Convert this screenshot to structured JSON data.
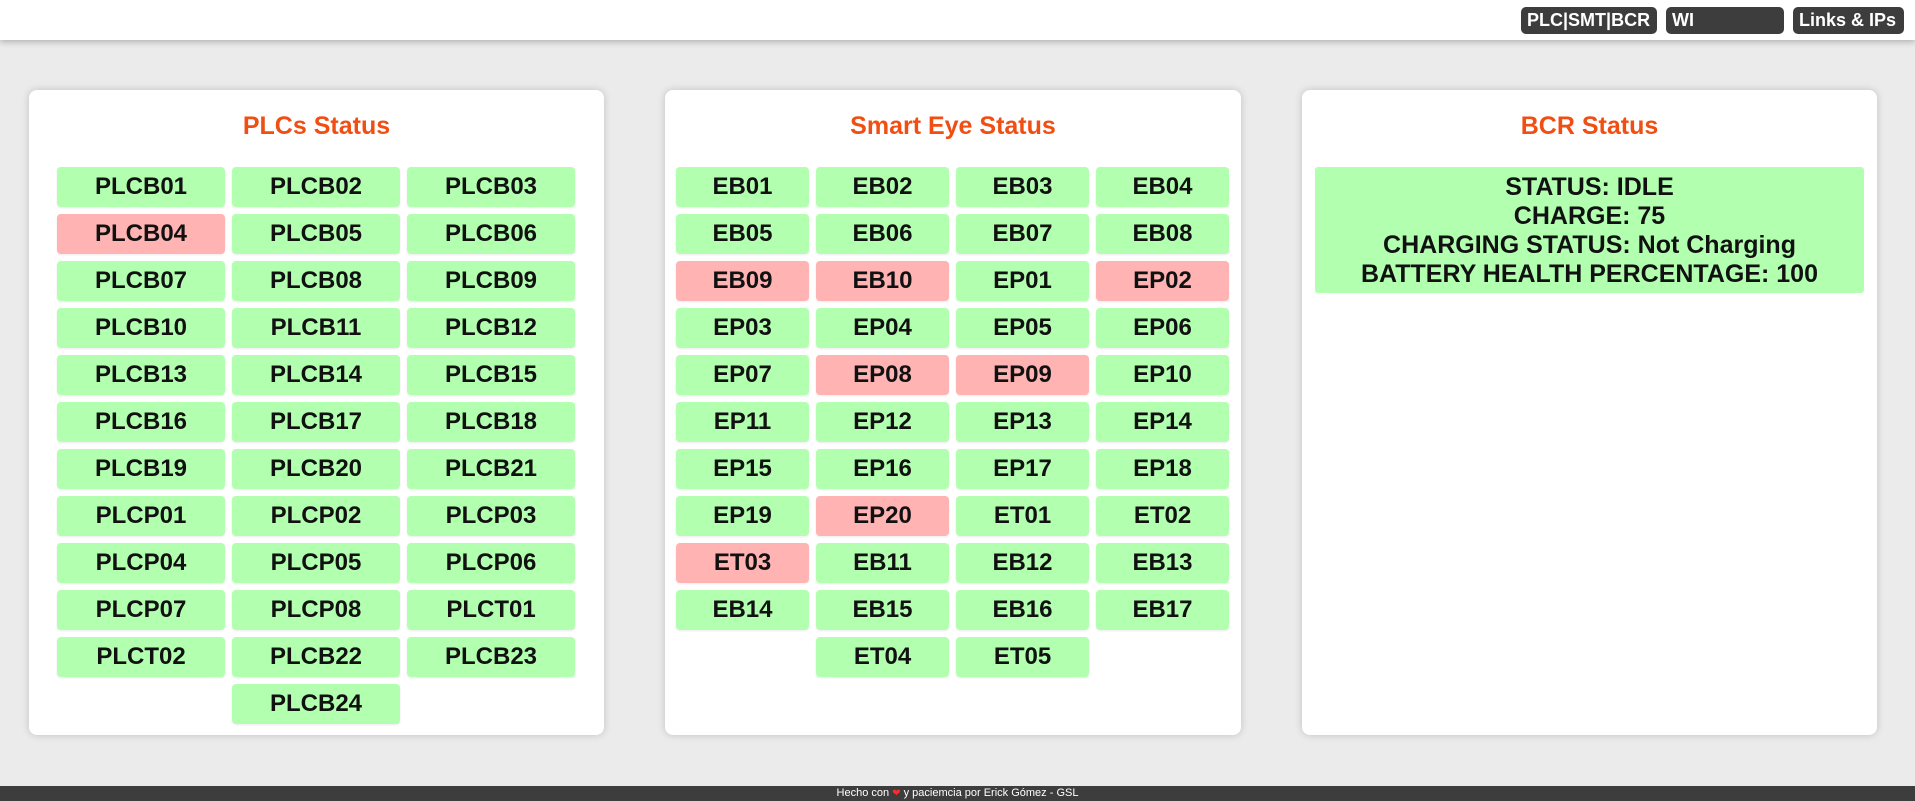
{
  "topbar": {
    "buttons": [
      "PLC|SMT|BCR",
      "WI",
      "Links & IPs"
    ]
  },
  "colors": {
    "ok": "#b2ffb0",
    "error": "#ffb3b3",
    "title": "#f04e12",
    "button_bg": "#3d3d3d"
  },
  "plc_panel": {
    "title": "PLCs Status",
    "items": [
      {
        "label": "PLCB01",
        "status": "ok"
      },
      {
        "label": "PLCB02",
        "status": "ok"
      },
      {
        "label": "PLCB03",
        "status": "ok"
      },
      {
        "label": "PLCB04",
        "status": "error"
      },
      {
        "label": "PLCB05",
        "status": "ok"
      },
      {
        "label": "PLCB06",
        "status": "ok"
      },
      {
        "label": "PLCB07",
        "status": "ok"
      },
      {
        "label": "PLCB08",
        "status": "ok"
      },
      {
        "label": "PLCB09",
        "status": "ok"
      },
      {
        "label": "PLCB10",
        "status": "ok"
      },
      {
        "label": "PLCB11",
        "status": "ok"
      },
      {
        "label": "PLCB12",
        "status": "ok"
      },
      {
        "label": "PLCB13",
        "status": "ok"
      },
      {
        "label": "PLCB14",
        "status": "ok"
      },
      {
        "label": "PLCB15",
        "status": "ok"
      },
      {
        "label": "PLCB16",
        "status": "ok"
      },
      {
        "label": "PLCB17",
        "status": "ok"
      },
      {
        "label": "PLCB18",
        "status": "ok"
      },
      {
        "label": "PLCB19",
        "status": "ok"
      },
      {
        "label": "PLCB20",
        "status": "ok"
      },
      {
        "label": "PLCB21",
        "status": "ok"
      },
      {
        "label": "PLCP01",
        "status": "ok"
      },
      {
        "label": "PLCP02",
        "status": "ok"
      },
      {
        "label": "PLCP03",
        "status": "ok"
      },
      {
        "label": "PLCP04",
        "status": "ok"
      },
      {
        "label": "PLCP05",
        "status": "ok"
      },
      {
        "label": "PLCP06",
        "status": "ok"
      },
      {
        "label": "PLCP07",
        "status": "ok"
      },
      {
        "label": "PLCP08",
        "status": "ok"
      },
      {
        "label": "PLCT01",
        "status": "ok"
      },
      {
        "label": "PLCT02",
        "status": "ok"
      },
      {
        "label": "PLCB22",
        "status": "ok"
      },
      {
        "label": "PLCB23",
        "status": "ok"
      },
      {
        "label": "",
        "status": "empty"
      },
      {
        "label": "PLCB24",
        "status": "ok"
      },
      {
        "label": "",
        "status": "empty"
      }
    ]
  },
  "smart_eye_panel": {
    "title": "Smart Eye Status",
    "items": [
      {
        "label": "EB01",
        "status": "ok"
      },
      {
        "label": "EB02",
        "status": "ok"
      },
      {
        "label": "EB03",
        "status": "ok"
      },
      {
        "label": "EB04",
        "status": "ok"
      },
      {
        "label": "EB05",
        "status": "ok"
      },
      {
        "label": "EB06",
        "status": "ok"
      },
      {
        "label": "EB07",
        "status": "ok"
      },
      {
        "label": "EB08",
        "status": "ok"
      },
      {
        "label": "EB09",
        "status": "error"
      },
      {
        "label": "EB10",
        "status": "error"
      },
      {
        "label": "EP01",
        "status": "ok"
      },
      {
        "label": "EP02",
        "status": "error"
      },
      {
        "label": "EP03",
        "status": "ok"
      },
      {
        "label": "EP04",
        "status": "ok"
      },
      {
        "label": "EP05",
        "status": "ok"
      },
      {
        "label": "EP06",
        "status": "ok"
      },
      {
        "label": "EP07",
        "status": "ok"
      },
      {
        "label": "EP08",
        "status": "error"
      },
      {
        "label": "EP09",
        "status": "error"
      },
      {
        "label": "EP10",
        "status": "ok"
      },
      {
        "label": "EP11",
        "status": "ok"
      },
      {
        "label": "EP12",
        "status": "ok"
      },
      {
        "label": "EP13",
        "status": "ok"
      },
      {
        "label": "EP14",
        "status": "ok"
      },
      {
        "label": "EP15",
        "status": "ok"
      },
      {
        "label": "EP16",
        "status": "ok"
      },
      {
        "label": "EP17",
        "status": "ok"
      },
      {
        "label": "EP18",
        "status": "ok"
      },
      {
        "label": "EP19",
        "status": "ok"
      },
      {
        "label": "EP20",
        "status": "error"
      },
      {
        "label": "ET01",
        "status": "ok"
      },
      {
        "label": "ET02",
        "status": "ok"
      },
      {
        "label": "ET03",
        "status": "error"
      },
      {
        "label": "EB11",
        "status": "ok"
      },
      {
        "label": "EB12",
        "status": "ok"
      },
      {
        "label": "EB13",
        "status": "ok"
      },
      {
        "label": "EB14",
        "status": "ok"
      },
      {
        "label": "EB15",
        "status": "ok"
      },
      {
        "label": "EB16",
        "status": "ok"
      },
      {
        "label": "EB17",
        "status": "ok"
      },
      {
        "label": "",
        "status": "empty"
      },
      {
        "label": "ET04",
        "status": "ok"
      },
      {
        "label": "ET05",
        "status": "ok"
      },
      {
        "label": "",
        "status": "empty"
      }
    ]
  },
  "bcr_panel": {
    "title": "BCR Status",
    "lines": [
      "STATUS: IDLE",
      "CHARGE: 75",
      "CHARGING STATUS: Not Charging",
      "BATTERY HEALTH PERCENTAGE: 100"
    ]
  },
  "footer": {
    "text_before": "Hecho con",
    "heart_icon": "heart-icon",
    "heart_glyph": "❤",
    "text_after": "y paciemcia por Erick Gómez - GSL"
  }
}
